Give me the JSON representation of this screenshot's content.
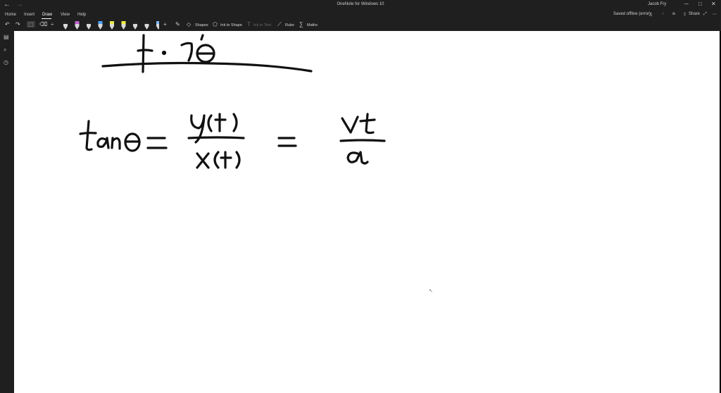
{
  "titlebar": {
    "back": "←",
    "forward": "→",
    "title": "OneNote for Windows 10",
    "user": "Jacob Fry",
    "minimize": "─",
    "maximize": "□",
    "close": "✕"
  },
  "menu": {
    "tabs": [
      "Home",
      "Insert",
      "Draw",
      "View",
      "Help"
    ],
    "active_tab": "Draw",
    "status": "Saved offline (error)",
    "share": "Share"
  },
  "toolbar": {
    "shapes_label": "Shapes",
    "ink_to_shape_label": "Ink to Shape",
    "ink_to_text_label": "Ink to Text",
    "ruler_label": "Ruler",
    "maths_label": "Maths",
    "pen_colors": [
      "#222222",
      "#c060d0",
      "#222222",
      "#4da3ff",
      "#e8e84a",
      "#f0f040",
      "#222222",
      "#222222",
      "#7cb7ff",
      "#222222"
    ]
  },
  "colors": {
    "chrome_bg": "#1f1f1f",
    "page_bg": "#ffffff",
    "ink": "#111111"
  }
}
